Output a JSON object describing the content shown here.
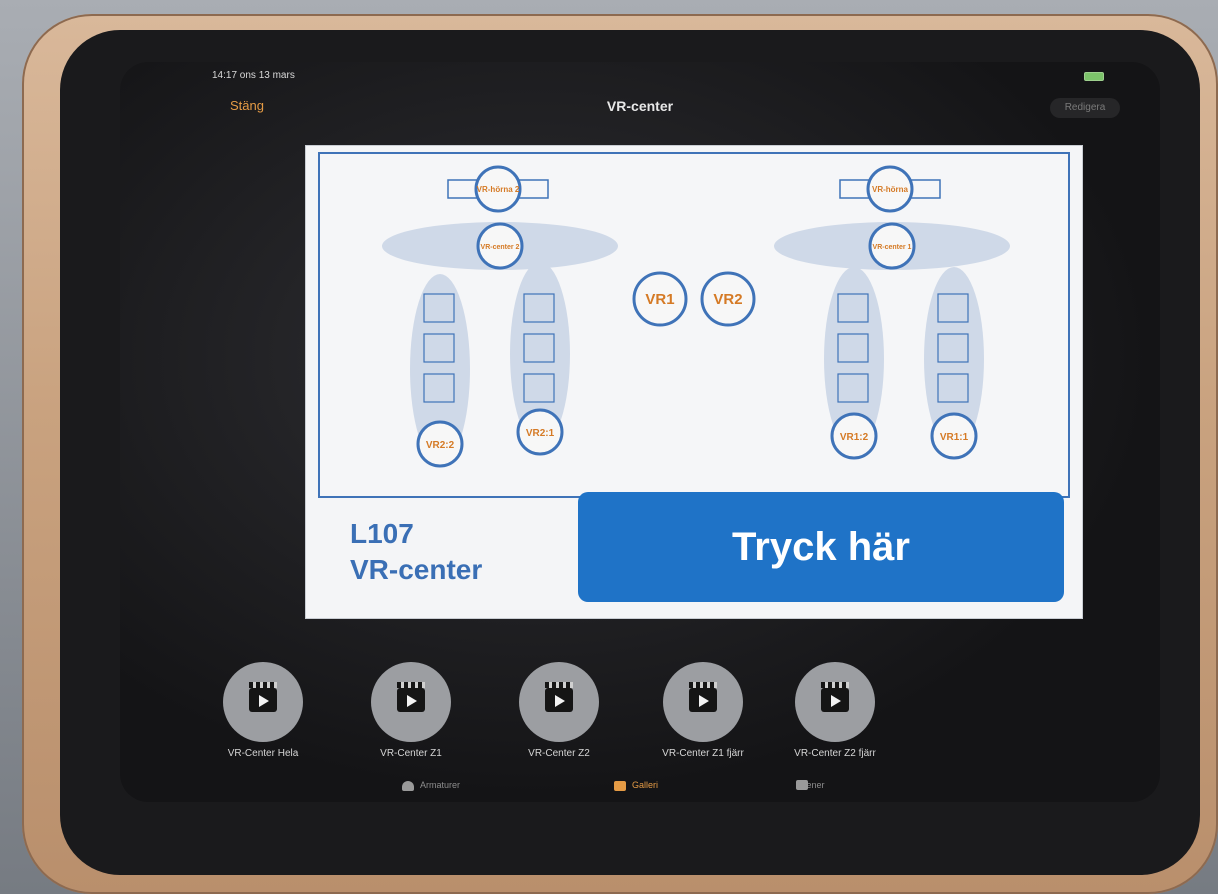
{
  "device": {
    "status_time": "14:17  ons 13 mars"
  },
  "navbar": {
    "close_label": "Stäng",
    "title": "VR-center",
    "right_label": "Redigera"
  },
  "panel": {
    "room_code": "L107",
    "room_name": "VR-center",
    "press_button": "Tryck här",
    "areas": {
      "left_top_small": "VR-hörna 2",
      "left_mid_small": "VR-center 2",
      "right_top_small": "VR-hörna",
      "right_mid_small": "VR-center 1",
      "vr1": "VR1",
      "vr2": "VR2",
      "vr2_2": "VR2:2",
      "vr2_1": "VR2:1",
      "vr1_2": "VR1:2",
      "vr1_1": "VR1:1"
    }
  },
  "scenes": [
    {
      "label": "VR-Center Hela"
    },
    {
      "label": "VR-Center Z1"
    },
    {
      "label": "VR-Center Z2"
    },
    {
      "label": "VR-Center Z1 fjärr"
    },
    {
      "label": "VR-Center Z2 fjärr"
    }
  ],
  "tabs": [
    {
      "label": "Armaturer"
    },
    {
      "label": "Galleri"
    },
    {
      "label": "Scener"
    }
  ],
  "colors": {
    "accent_orange": "#e59b45",
    "panel_blue": "#1f73c7",
    "outline_blue": "#3f73b8"
  }
}
